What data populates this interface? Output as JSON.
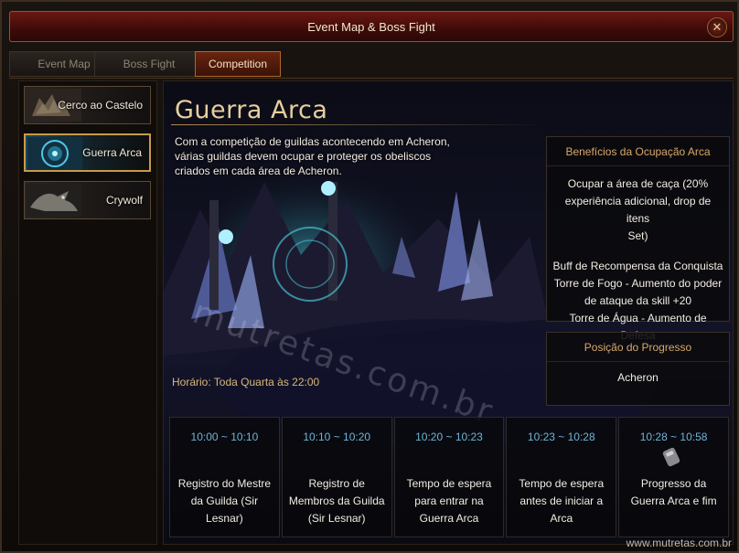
{
  "window": {
    "title": "Event Map & Boss Fight",
    "close_glyph": "✕"
  },
  "tabs": [
    {
      "label": "Event Map",
      "active": false
    },
    {
      "label": "Boss Fight",
      "active": false
    },
    {
      "label": "Competition",
      "active": true
    }
  ],
  "sidebar": {
    "items": [
      {
        "label": "Cerco ao Castelo",
        "icon": "castle-siege-icon",
        "active": false
      },
      {
        "label": "Guerra Arca",
        "icon": "arca-war-icon",
        "active": true
      },
      {
        "label": "Crywolf",
        "icon": "crywolf-icon",
        "active": false
      }
    ]
  },
  "main": {
    "title": "Guerra Arca",
    "description": "Com a competição de guildas acontecendo em Acheron, várias guildas devem ocupar e proteger os obeliscos criados em cada área de Acheron.",
    "schedule": "Horário: Toda Quarta às 22:00"
  },
  "benefits": {
    "header": "Benefícios da Ocupação Arca",
    "lines_a": [
      "Ocupar a área de caça (20%",
      "experiência adicional, drop de itens",
      "Set)"
    ],
    "lines_b": [
      "Buff de Recompensa da Conquista",
      "Torre de Fogo - Aumento do poder",
      "de ataque da skill +20",
      "Torre de Água - Aumento de Defesa"
    ]
  },
  "progress": {
    "header": "Posição do Progresso",
    "location": "Acheron"
  },
  "timeline": [
    {
      "time": "10:00 ~ 10:10",
      "stage": "Registro do Mestre da Guilda (Sir Lesnar)"
    },
    {
      "time": "10:10 ~ 10:20",
      "stage": "Registro de Membros da Guilda (Sir Lesnar)"
    },
    {
      "time": "10:20 ~ 10:23",
      "stage": "Tempo de espera para entrar na Guerra Arca"
    },
    {
      "time": "10:23 ~ 10:28",
      "stage": "Tempo de espera antes de iniciar a Arca"
    },
    {
      "time": "10:28 ~ 10:58",
      "stage": "Progresso da Guerra Arca e fim"
    }
  ],
  "watermark": "mutretas.com.br",
  "footer_watermark": "www.mutretas.com.br",
  "colors": {
    "accent_gold": "#e6cf9e",
    "time_blue": "#6fb4d8",
    "header_orange": "#d8a86a",
    "title_red": "#6b1712"
  }
}
